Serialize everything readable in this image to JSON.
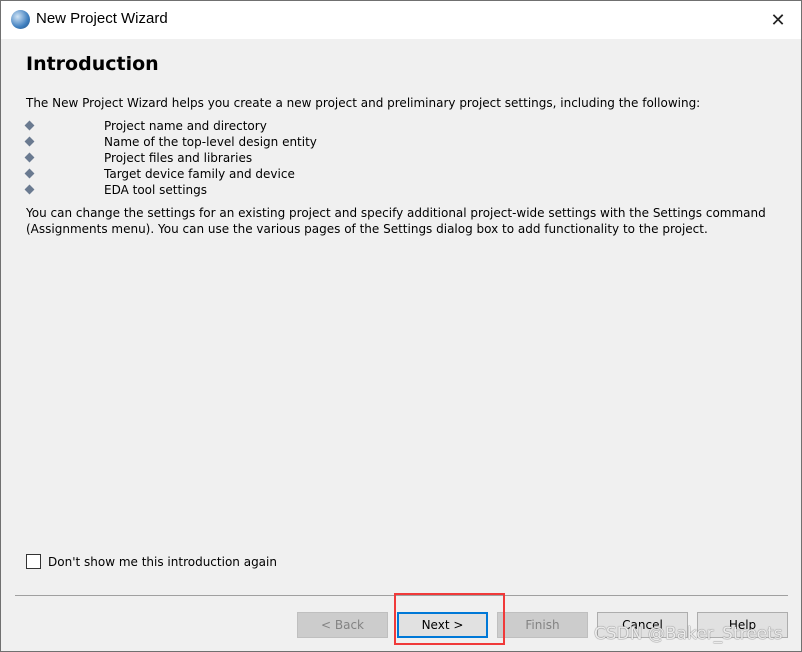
{
  "window": {
    "title": "New Project Wizard",
    "close": "✕"
  },
  "page": {
    "heading": "Introduction",
    "intro": "The New Project Wizard helps you create a new project and preliminary project settings, including the following:",
    "bullets": [
      "Project name and directory",
      "Name of the top-level design entity",
      "Project files and libraries",
      "Target device family and device",
      "EDA tool settings"
    ],
    "note": "You can change the settings for an existing project and specify additional project-wide settings with the Settings command (Assignments menu). You can use the various pages of the Settings dialog box to add functionality to the project."
  },
  "checkbox": {
    "label": "Don't show me this introduction again",
    "checked": false
  },
  "buttons": {
    "back": "< Back",
    "next": "Next >",
    "finish": "Finish",
    "cancel": "Cancel",
    "help": "Help"
  },
  "watermark": "CSDN @Baker_Streets"
}
